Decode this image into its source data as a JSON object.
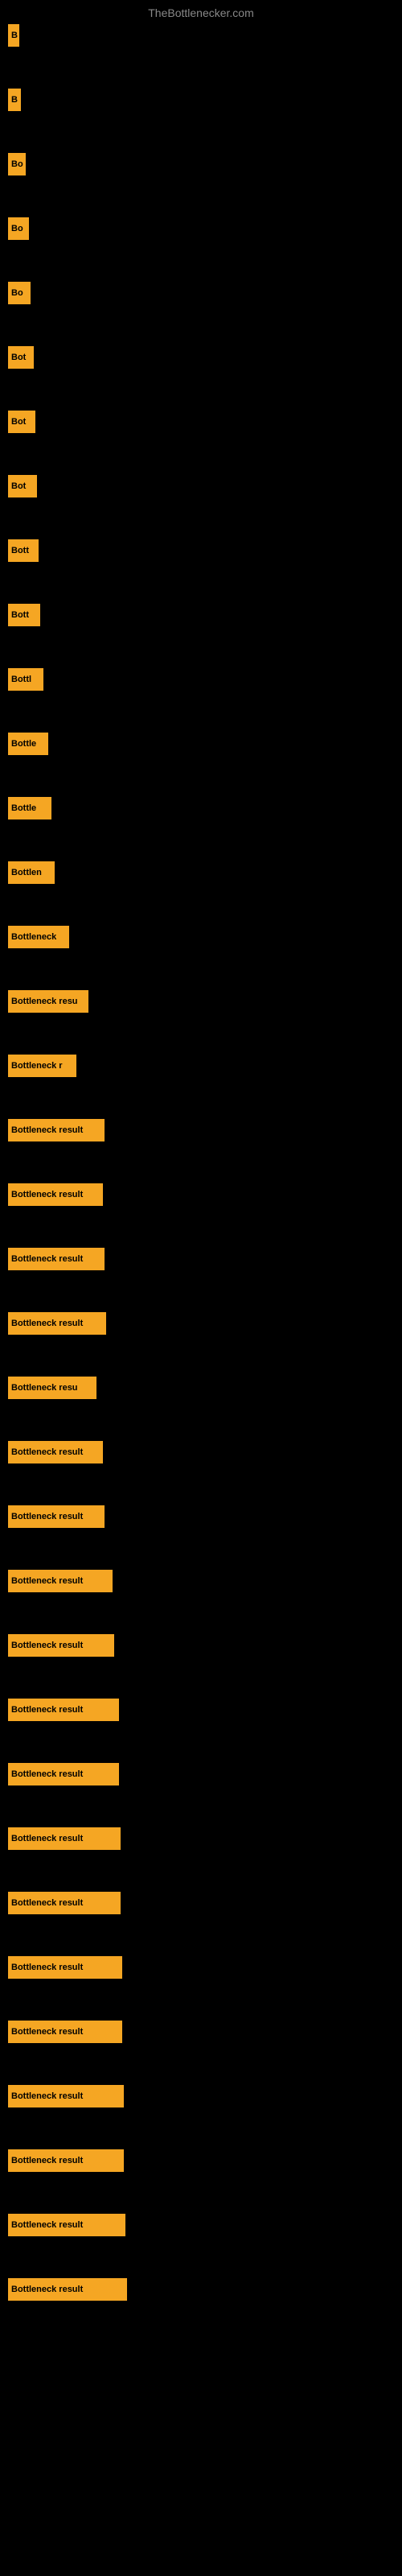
{
  "site": {
    "title": "TheBottlenecker.com"
  },
  "bars": [
    {
      "label": "B",
      "width": 14
    },
    {
      "label": "B",
      "width": 16
    },
    {
      "label": "Bo",
      "width": 22
    },
    {
      "label": "Bo",
      "width": 26
    },
    {
      "label": "Bo",
      "width": 28
    },
    {
      "label": "Bot",
      "width": 32
    },
    {
      "label": "Bot",
      "width": 34
    },
    {
      "label": "Bot",
      "width": 36
    },
    {
      "label": "Bott",
      "width": 38
    },
    {
      "label": "Bott",
      "width": 40
    },
    {
      "label": "Bottl",
      "width": 44
    },
    {
      "label": "Bottle",
      "width": 50
    },
    {
      "label": "Bottle",
      "width": 54
    },
    {
      "label": "Bottlen",
      "width": 58
    },
    {
      "label": "Bottleneck",
      "width": 76
    },
    {
      "label": "Bottleneck resu",
      "width": 100
    },
    {
      "label": "Bottleneck r",
      "width": 85
    },
    {
      "label": "Bottleneck result",
      "width": 120
    },
    {
      "label": "Bottleneck result",
      "width": 118
    },
    {
      "label": "Bottleneck result",
      "width": 120
    },
    {
      "label": "Bottleneck result",
      "width": 122
    },
    {
      "label": "Bottleneck resu",
      "width": 110
    },
    {
      "label": "Bottleneck result",
      "width": 118
    },
    {
      "label": "Bottleneck result",
      "width": 120
    },
    {
      "label": "Bottleneck result",
      "width": 130
    },
    {
      "label": "Bottleneck result",
      "width": 132
    },
    {
      "label": "Bottleneck result",
      "width": 138
    },
    {
      "label": "Bottleneck result",
      "width": 138
    },
    {
      "label": "Bottleneck result",
      "width": 140
    },
    {
      "label": "Bottleneck result",
      "width": 140
    },
    {
      "label": "Bottleneck result",
      "width": 142
    },
    {
      "label": "Bottleneck result",
      "width": 142
    },
    {
      "label": "Bottleneck result",
      "width": 144
    },
    {
      "label": "Bottleneck result",
      "width": 144
    },
    {
      "label": "Bottleneck result",
      "width": 146
    },
    {
      "label": "Bottleneck result",
      "width": 148
    }
  ]
}
